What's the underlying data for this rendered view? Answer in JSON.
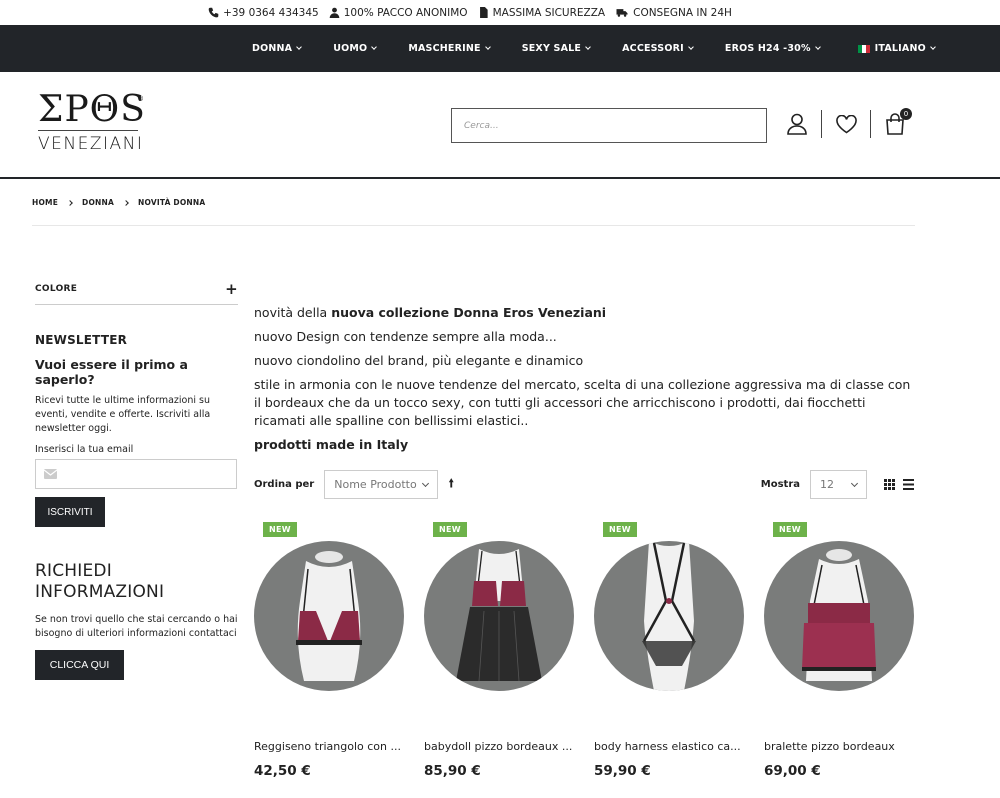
{
  "infobar": {
    "phone": "+39 0364 434345",
    "anon": "100% PACCO ANONIMO",
    "secure": "MASSIMA SICUREZZA",
    "delivery": "CONSEGNA IN 24H"
  },
  "nav": {
    "items": [
      "DONNA",
      "UOMO",
      "MASCHERINE",
      "SEXY SALE",
      "ACCESSORI",
      "EROS H24 -30%"
    ],
    "language": "ITALIANO"
  },
  "header": {
    "logo_top": "ΣΡΘS",
    "logo_bottom": "VENEZIANI",
    "search_placeholder": "Cerca...",
    "cart_count": "0"
  },
  "breadcrumb": [
    "HOME",
    "DONNA",
    "NOVITÀ DONNA"
  ],
  "sidebar": {
    "filter_label": "COLORE",
    "filter_toggle": "+",
    "newsletter_title": "NEWSLETTER",
    "newsletter_subtitle": "Vuoi essere il primo a saperlo?",
    "newsletter_text": "Ricevi tutte le ultime informazioni su eventi, vendite e offerte. Iscriviti alla newsletter oggi.",
    "email_label": "Inserisci la tua email",
    "subscribe_label": "ISCRIVITI",
    "request_title": "RICHIEDI INFORMAZIONI",
    "request_text": "Se non trovi quello che stai cercando o hai bisogno di ulteriori informazioni contattaci",
    "request_button": "CLICCA QUI"
  },
  "intro": {
    "line1_prefix": "novità della ",
    "line1_bold": "nuova collezione Donna Eros Veneziani",
    "line2": "nuovo Design con tendenze sempre alla moda...",
    "line3": "nuovo ciondolino del brand, più elegante e dinamico",
    "line4": "stile in armonia con le nuove tendenze del mercato, scelta di una collezione aggressiva ma di classe con il bordeaux che da un tocco sexy, con tutti gli accessori che arricchiscono i prodotti, dai fiocchetti ricamati alle spalline con bellissimi elastici..",
    "line5": "prodotti made in Italy"
  },
  "toolbar": {
    "sort_label": "Ordina per",
    "sort_value": "Nome Prodotto",
    "show_label": "Mostra",
    "show_value": "12"
  },
  "products": [
    {
      "badge": "NEW",
      "name": "Reggiseno triangolo con ...",
      "price": "42,50 €"
    },
    {
      "badge": "NEW",
      "name": "babydoll pizzo bordeaux ...",
      "price": "85,90 €"
    },
    {
      "badge": "NEW",
      "name": "body harness elastico ca...",
      "price": "59,90 €"
    },
    {
      "badge": "NEW",
      "name": "bralette pizzo bordeaux",
      "price": "69,00 €"
    }
  ],
  "colors": {
    "nav_bg": "#222529",
    "badge_green": "#6db24a",
    "product_circle": "#7a7c7b",
    "lace_bordeaux": "#8b2a46"
  }
}
